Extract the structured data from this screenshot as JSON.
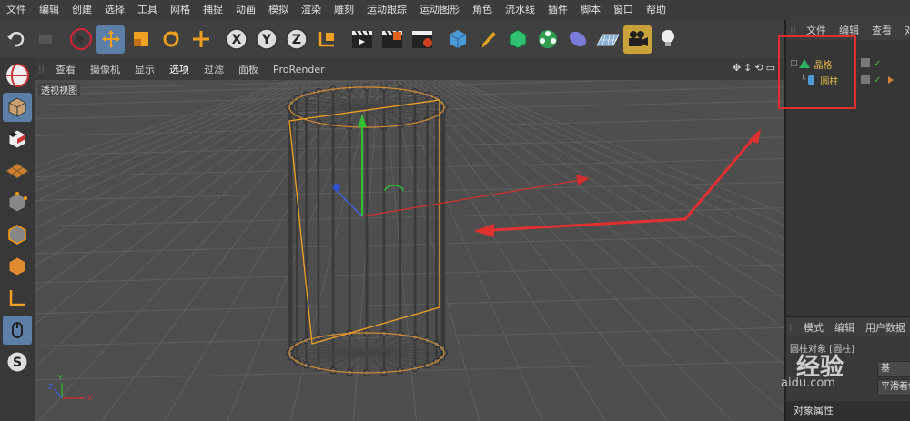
{
  "menubar": [
    "文件",
    "编辑",
    "创建",
    "选择",
    "工具",
    "网格",
    "捕捉",
    "动画",
    "模拟",
    "渲染",
    "雕刻",
    "运动跟踪",
    "运动图形",
    "角色",
    "流水线",
    "插件",
    "脚本",
    "窗口",
    "帮助"
  ],
  "toolbar": {
    "undo": "undo-icon",
    "axis_x": "X",
    "axis_y": "Y",
    "axis_z": "Z"
  },
  "viewport_menu": [
    "查看",
    "摄像机",
    "显示",
    "选项",
    "过滤",
    "面板",
    "ProRender"
  ],
  "viewport_label": "透视视图",
  "object_manager": {
    "tabs": [
      "文件",
      "编辑",
      "查看",
      "对"
    ],
    "objects": [
      {
        "name": "晶格",
        "tree": "□"
      },
      {
        "name": "圆柱",
        "tree": "└"
      }
    ]
  },
  "attributes": {
    "tabs": [
      "模式",
      "编辑",
      "用户数据"
    ],
    "title": "圆柱对象 [圆柱]",
    "cells": [
      "基",
      "平滑着色"
    ],
    "footer": "对象属性"
  },
  "watermark": {
    "brand": "经验",
    "domain": "aidu.com"
  },
  "colors": {
    "accent": "#5c7fa8",
    "highlight": "#c9a23a",
    "annotation": "#e03030",
    "object": "#e6b84a"
  }
}
